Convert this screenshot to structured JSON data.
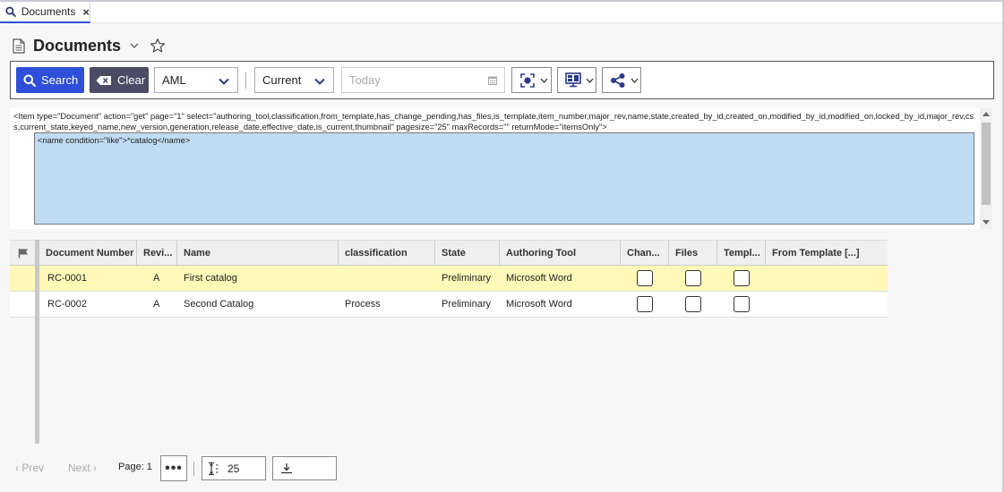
{
  "tab": {
    "label": "Documents",
    "close": "×",
    "icon": "search-icon"
  },
  "header": {
    "title": "Documents",
    "icons": [
      "document-icon",
      "chevron-down-icon",
      "star-icon"
    ]
  },
  "toolbar": {
    "search_label": "Search",
    "clear_label": "Clear",
    "query_type": "AML",
    "version_filter": "Current",
    "date_placeholder": "Today",
    "icons": [
      "search-icon",
      "clear-icon",
      "calendar-icon",
      "target-icon",
      "monitor-icon",
      "share-icon"
    ]
  },
  "aml": {
    "item_line": "<Item type=\"Document\" action=\"get\" page=\"1\" select=\"authoring_tool,classification,from_template,has_change_pending,has_files,is_template,item_number,major_rev,name,state,created_by_id,created_on,modified_by_id,modified_on,locked_by_id,major_rev,css,current_state,keyed_name,new_version,generation,release_date,effective_date,is_current,thumbnail\" pagesize=\"25\" maxRecords=\"\" returnMode=\"itemsOnly\">",
    "criteria": "<name condition=\"like\">*catalog</name>"
  },
  "grid": {
    "columns": [
      "Document Number",
      "Revi...",
      "Name",
      "classification",
      "State",
      "Authoring Tool",
      "Chan...",
      "Files",
      "Templ...",
      "From Template [...]"
    ],
    "rows": [
      {
        "number": "RC-0001",
        "rev": "A",
        "name": "First catalog",
        "classification": "",
        "state": "Preliminary",
        "tool": "Microsoft Word",
        "changes": false,
        "files": false,
        "template": false,
        "from_template": ""
      },
      {
        "number": "RC-0002",
        "rev": "A",
        "name": "Second Catalog",
        "classification": "Process",
        "state": "Preliminary",
        "tool": "Microsoft Word",
        "changes": false,
        "files": false,
        "template": false,
        "from_template": ""
      }
    ]
  },
  "pager": {
    "prev": "‹ Prev",
    "next": "Next ›",
    "page": "Page: 1",
    "more": "•••",
    "page_size": "25"
  }
}
